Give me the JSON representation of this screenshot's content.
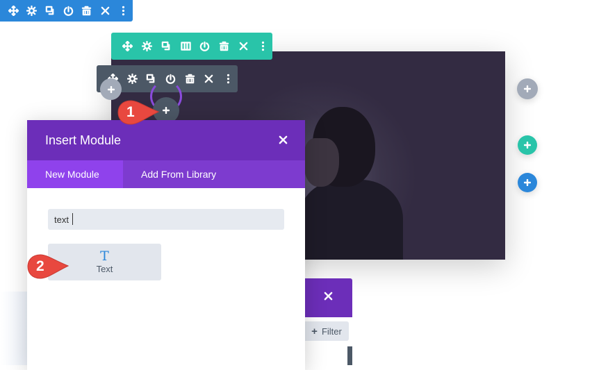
{
  "toolbars": {
    "section": {
      "color": "#2b87da",
      "icons": [
        "move-icon",
        "gear-icon",
        "duplicate-icon",
        "power-icon",
        "trash-icon",
        "close-icon",
        "more-icon"
      ]
    },
    "row": {
      "color": "#29c4a9",
      "icons": [
        "move-icon",
        "gear-icon",
        "duplicate-icon",
        "columns-icon",
        "power-icon",
        "trash-icon",
        "close-icon",
        "more-icon"
      ]
    },
    "module": {
      "color": "#4c5866",
      "icons": [
        "move-icon",
        "gear-icon",
        "duplicate-icon",
        "power-icon",
        "trash-icon",
        "close-icon",
        "more-icon"
      ]
    }
  },
  "callouts": {
    "step1": "1",
    "step2": "2",
    "color": "#e8483f"
  },
  "modal": {
    "title": "Insert Module",
    "header_color": "#6c2eb9",
    "tabs": [
      {
        "label": "New Module",
        "active": true
      },
      {
        "label": "Add From Library",
        "active": false
      }
    ],
    "search": {
      "value": "text",
      "placeholder": ""
    },
    "modules": [
      {
        "label": "Text",
        "icon": "T"
      }
    ]
  },
  "second_panel": {
    "filter_label": "Filter",
    "filter_icon": "+"
  },
  "add_buttons": {
    "plus": "+",
    "colors": {
      "gray": "#a2aab8",
      "green": "#29c4a9",
      "blue": "#2b87da"
    }
  }
}
